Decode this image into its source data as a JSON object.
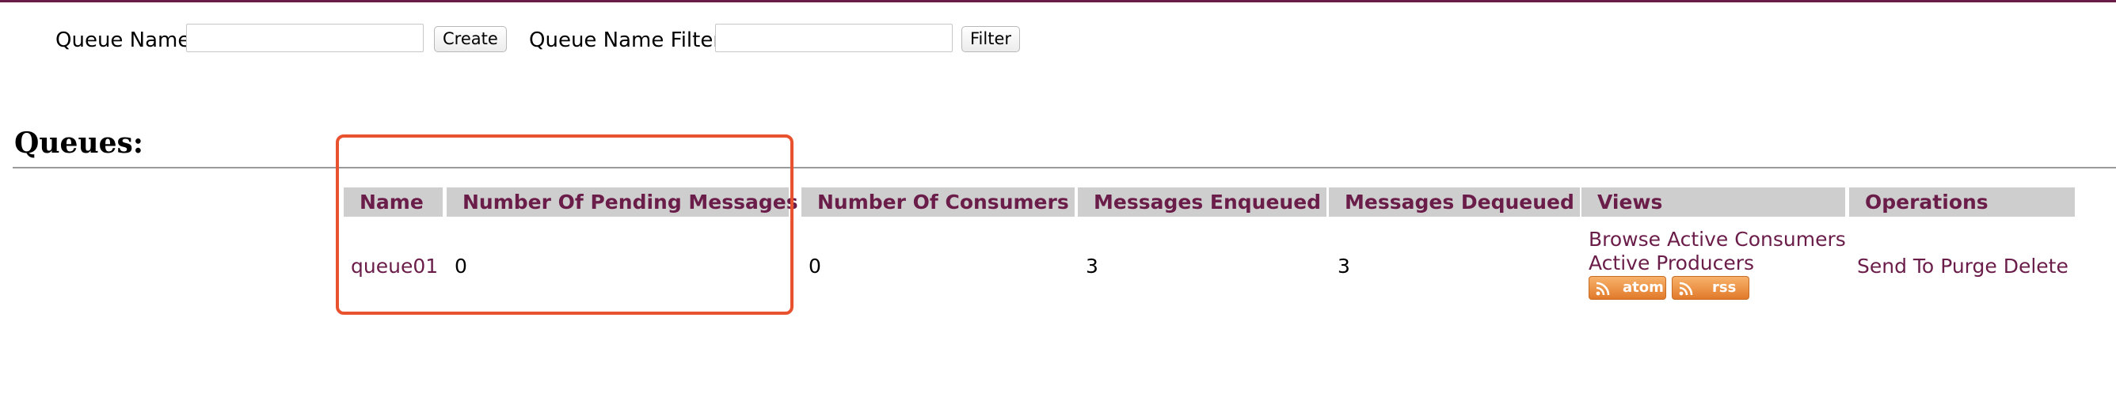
{
  "form": {
    "queue_name_label": "Queue Name",
    "queue_name_value": "",
    "create_label": "Create",
    "filter_label_text": "Queue Name Filter",
    "filter_value": "",
    "filter_button_label": "Filter"
  },
  "heading": "Queues:",
  "table": {
    "headers": [
      "Name",
      "Number Of Pending Messages",
      "Number Of Consumers",
      "Messages Enqueued",
      "Messages Dequeued",
      "Views",
      "Operations"
    ],
    "rows": [
      {
        "name": "queue01",
        "pending": "0",
        "consumers": "0",
        "enqueued": "3",
        "dequeued": "3",
        "views": {
          "browse_active_consumers": "Browse Active Consumers",
          "active_producers": "Active Producers",
          "atom": "atom",
          "rss": "rss"
        },
        "operations": [
          "Send To",
          "Purge",
          "Delete"
        ]
      }
    ]
  },
  "colors": {
    "accent": "#6b1d4a",
    "header_bg": "#cecece",
    "highlight": "#e8522f",
    "feed_orange": "#e17a2a"
  },
  "icons": {
    "feed": "rss-feed-icon"
  }
}
